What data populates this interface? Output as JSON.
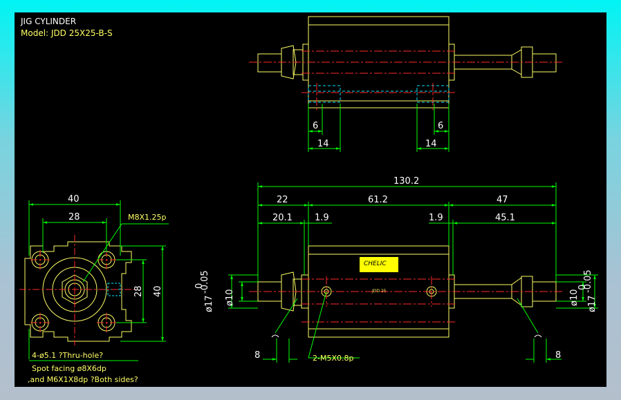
{
  "title": "JIG CYLINDER",
  "model": "Model: JDD 25X25-B-S",
  "dims_top": {
    "left": "6",
    "right": "6",
    "left_width": "14",
    "right_width": "14"
  },
  "dims_side": {
    "overall": "130.2",
    "left_rod": "22",
    "body": "61.2",
    "right_rod": "47",
    "left_inner": "20.1",
    "left_gap": "1.9",
    "right_gap": "1.9",
    "right_inner": "45.1",
    "rod_dia": "ø10",
    "rod_tol": "ø17",
    "tol_upper": "0",
    "tol_lower": "-0.05",
    "nut_width_left": "8",
    "nut_width_right": "8",
    "port": "2-M5X0.8p",
    "label_brand": "CHELIC",
    "center_mark": "JDD 25"
  },
  "dims_end": {
    "width": "40",
    "pitch": "28",
    "thread": "M8X1.25p",
    "v_pitch": "28",
    "v_height": "40",
    "hole_note": "4-ø5.1 ?Thru-hole?",
    "spot_note_1": "Spot facing  ø8X6dp",
    "spot_note_2": ",and M6X1X8dp ?Both sides?"
  },
  "colors": {
    "outline": "#ffff66",
    "dimension": "#00ff00",
    "center": "#ff2a2a",
    "hidden": "#00e5ff",
    "text": "#ffffff"
  }
}
